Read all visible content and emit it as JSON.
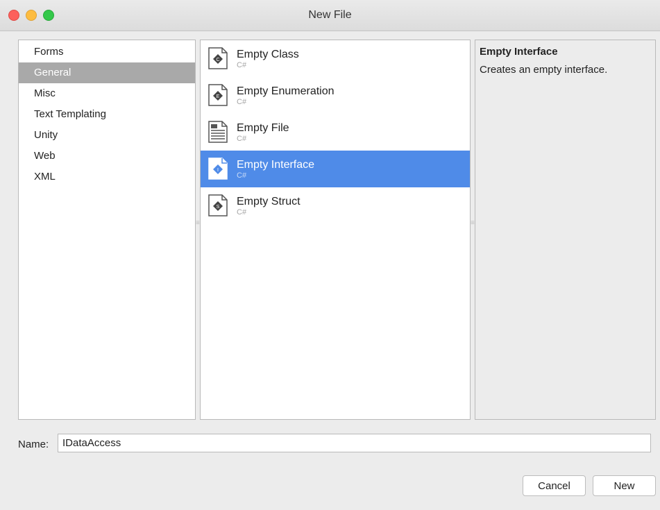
{
  "window": {
    "title": "New File"
  },
  "categories": [
    {
      "label": "Forms",
      "selected": false
    },
    {
      "label": "General",
      "selected": true
    },
    {
      "label": "Misc",
      "selected": false
    },
    {
      "label": "Text Templating",
      "selected": false
    },
    {
      "label": "Unity",
      "selected": false
    },
    {
      "label": "Web",
      "selected": false
    },
    {
      "label": "XML",
      "selected": false
    }
  ],
  "templates": [
    {
      "name": "Empty Class",
      "lang": "C#",
      "icon": "class-icon",
      "selected": false
    },
    {
      "name": "Empty Enumeration",
      "lang": "C#",
      "icon": "enum-icon",
      "selected": false
    },
    {
      "name": "Empty File",
      "lang": "C#",
      "icon": "file-icon",
      "selected": false
    },
    {
      "name": "Empty Interface",
      "lang": "C#",
      "icon": "interface-icon",
      "selected": true
    },
    {
      "name": "Empty Struct",
      "lang": "C#",
      "icon": "struct-icon",
      "selected": false
    }
  ],
  "description": {
    "title": "Empty Interface",
    "text": "Creates an empty interface."
  },
  "name_field": {
    "label": "Name:",
    "value": "IDataAccess"
  },
  "buttons": {
    "cancel": "Cancel",
    "new": "New"
  },
  "colors": {
    "selection": "#4f8be8",
    "category_selection": "#a9a9a9"
  }
}
